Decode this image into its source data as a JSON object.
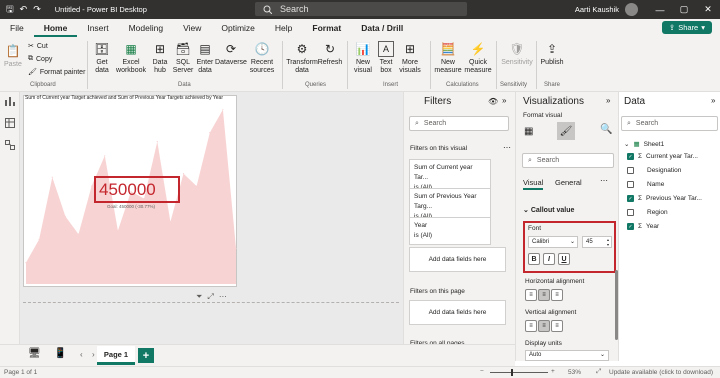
{
  "app": {
    "title": "Untitled - Power BI Desktop",
    "search_placeholder": "Search",
    "user": "Aarti Kaushik"
  },
  "menu": {
    "tabs": [
      "File",
      "Home",
      "Insert",
      "Modeling",
      "View",
      "Optimize",
      "Help",
      "Format",
      "Data / Drill"
    ],
    "share": "Share"
  },
  "ribbon": {
    "clipboard": {
      "paste": "Paste",
      "cut": "Cut",
      "copy": "Copy",
      "format_painter": "Format painter",
      "label": "Clipboard"
    },
    "data": {
      "get_data": "Get data",
      "excel": "Excel workbook",
      "datahub": "Data hub",
      "sql": "SQL Server",
      "enter_data": "Enter data",
      "dataverse": "Dataverse",
      "recent": "Recent sources",
      "label": "Data"
    },
    "queries": {
      "transform": "Transform data",
      "refresh": "Refresh",
      "label": "Queries"
    },
    "insert": {
      "new_visual": "New visual",
      "text_box": "Text box",
      "more_visuals": "More visuals",
      "label": "Insert"
    },
    "calculations": {
      "new_measure": "New measure",
      "quick_measure": "Quick measure",
      "label": "Calculations"
    },
    "sensitivity": {
      "sensitivity": "Sensitivity",
      "label": "Sensitivity"
    },
    "share": {
      "publish": "Publish",
      "label": "Share"
    }
  },
  "visual": {
    "title": "Sum of Current year Target achieved and Sum of Previous Year Targets achieved by Year",
    "callout": "450000",
    "goal": "Goal: 450000 (-30.77%)"
  },
  "chart_data": {
    "type": "area",
    "title": "Sum of Current year Target achieved and Sum of Previous Year Targets achieved by Year",
    "values": [
      0.12,
      0.25,
      0.6,
      0.38,
      0.28,
      0.55,
      0.72,
      0.3,
      0.52,
      0.48,
      0.8,
      0.35,
      0.62,
      0.55,
      0.85,
      0.98,
      0.2
    ],
    "color": "#f8d3d3"
  },
  "filters": {
    "title": "Filters",
    "search": "Search",
    "on_visual": "Filters on this visual",
    "cards": [
      {
        "name": "Sum of Current year Tar...",
        "value": "is (All)"
      },
      {
        "name": "Sum of Previous Year Targ...",
        "value": "is (All)"
      },
      {
        "name": "Year",
        "value": "is (All)"
      }
    ],
    "add": "Add data fields here",
    "on_page": "Filters on this page",
    "add2": "Add data fields here",
    "on_all": "Filters on all pages"
  },
  "viz": {
    "title": "Visualizations",
    "format_visual": "Format visual",
    "search": "Search",
    "tab_visual": "Visual",
    "tab_general": "General",
    "callout_value": "Callout value",
    "font": "Font",
    "font_name": "Calibri",
    "font_size": "45",
    "bold": "B",
    "italic": "I",
    "underline": "U",
    "h_align": "Horizontal alignment",
    "v_align": "Vertical alignment",
    "display_units": "Display units",
    "display_units_value": "Auto"
  },
  "data": {
    "title": "Data",
    "search": "Search",
    "table": "Sheet1",
    "fields": [
      {
        "name": "Current year Tar...",
        "sigma": true,
        "checked": true
      },
      {
        "name": "Designation",
        "sigma": false,
        "checked": false
      },
      {
        "name": "Name",
        "sigma": false,
        "checked": false
      },
      {
        "name": "Previous Year Tar...",
        "sigma": true,
        "checked": true
      },
      {
        "name": "Region",
        "sigma": false,
        "checked": false
      },
      {
        "name": "Year",
        "sigma": true,
        "checked": true
      }
    ]
  },
  "pages": {
    "tab": "Page 1"
  },
  "status": {
    "page": "Page 1 of 1",
    "zoom": "53%",
    "update": "Update available (click to download)"
  }
}
